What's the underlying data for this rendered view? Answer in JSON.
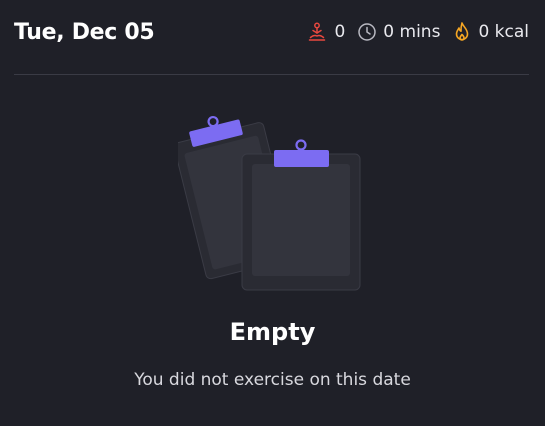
{
  "header": {
    "date": "Tue, Dec 05",
    "stats": {
      "sessions": {
        "icon": "meditation-icon",
        "value": "0",
        "color": "#e8483f"
      },
      "duration": {
        "icon": "clock-icon",
        "value": "0 mins",
        "color": "#b9b9c2"
      },
      "calories": {
        "icon": "flame-icon",
        "value": "0 kcal",
        "color": "#f5a623"
      }
    }
  },
  "empty_state": {
    "illustration": "clipboards-icon",
    "accent": "#7c6cf2",
    "title": "Empty",
    "subtitle": "You did not exercise on this date"
  }
}
